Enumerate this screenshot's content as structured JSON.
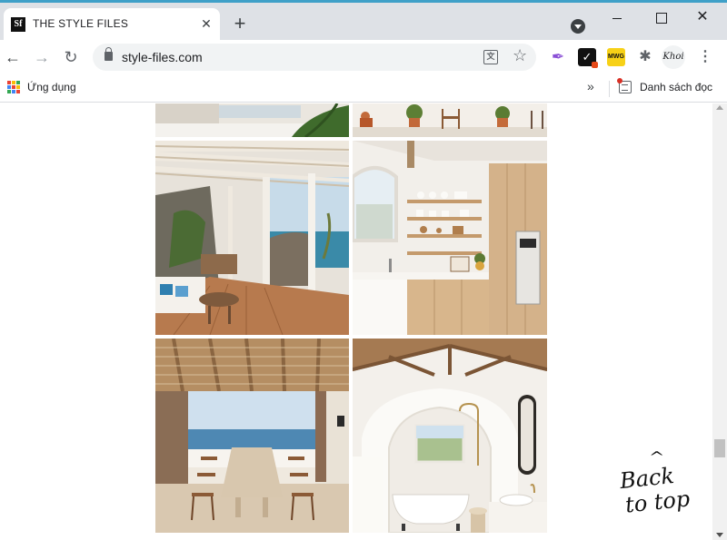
{
  "tab": {
    "favicon_text": "Sf",
    "title": "THE STYLE FILES",
    "close_glyph": "✕",
    "new_tab_glyph": "+"
  },
  "window_controls": {
    "close_glyph": "✕"
  },
  "toolbar": {
    "back_glyph": "←",
    "forward_glyph": "→",
    "reload_glyph": "↻",
    "url": "style-files.com",
    "translate_glyph": "文",
    "star_glyph": "☆",
    "check_glyph": "✓",
    "mwg_text": "MWG",
    "puzzle_glyph": "✱",
    "avatar_text": "Khoi",
    "menu_glyph": "⋮"
  },
  "bookmarks": {
    "apps_label": "Ứng dụng",
    "overflow_glyph": "»",
    "reading_list_label": "Danh sách đọc"
  },
  "gallery": {
    "images": [
      "terrace-partial-top-left",
      "patio-partial-top-right",
      "seaside-pergola-terrace",
      "minimal-wood-kitchen",
      "dining-table-sea-view",
      "arched-white-bathroom"
    ]
  },
  "back_to_top": {
    "caret": "^",
    "line1": "Back",
    "line2": "to top"
  },
  "colors": {
    "tab_strip": "#dee1e6",
    "accent_top": "#3fa0c8",
    "omnibox": "#f1f3f4"
  },
  "icons": [
    "tab-favicon",
    "close-icon",
    "plus-icon",
    "profile-dropdown-icon",
    "back-arrow-icon",
    "forward-arrow-icon",
    "reload-icon",
    "lock-icon",
    "translate-icon",
    "star-icon",
    "quill-extension-icon",
    "check-extension-icon",
    "mwg-extension-icon",
    "puzzle-icon",
    "avatar",
    "kebab-menu-icon",
    "apps-grid-icon",
    "reading-list-icon"
  ]
}
